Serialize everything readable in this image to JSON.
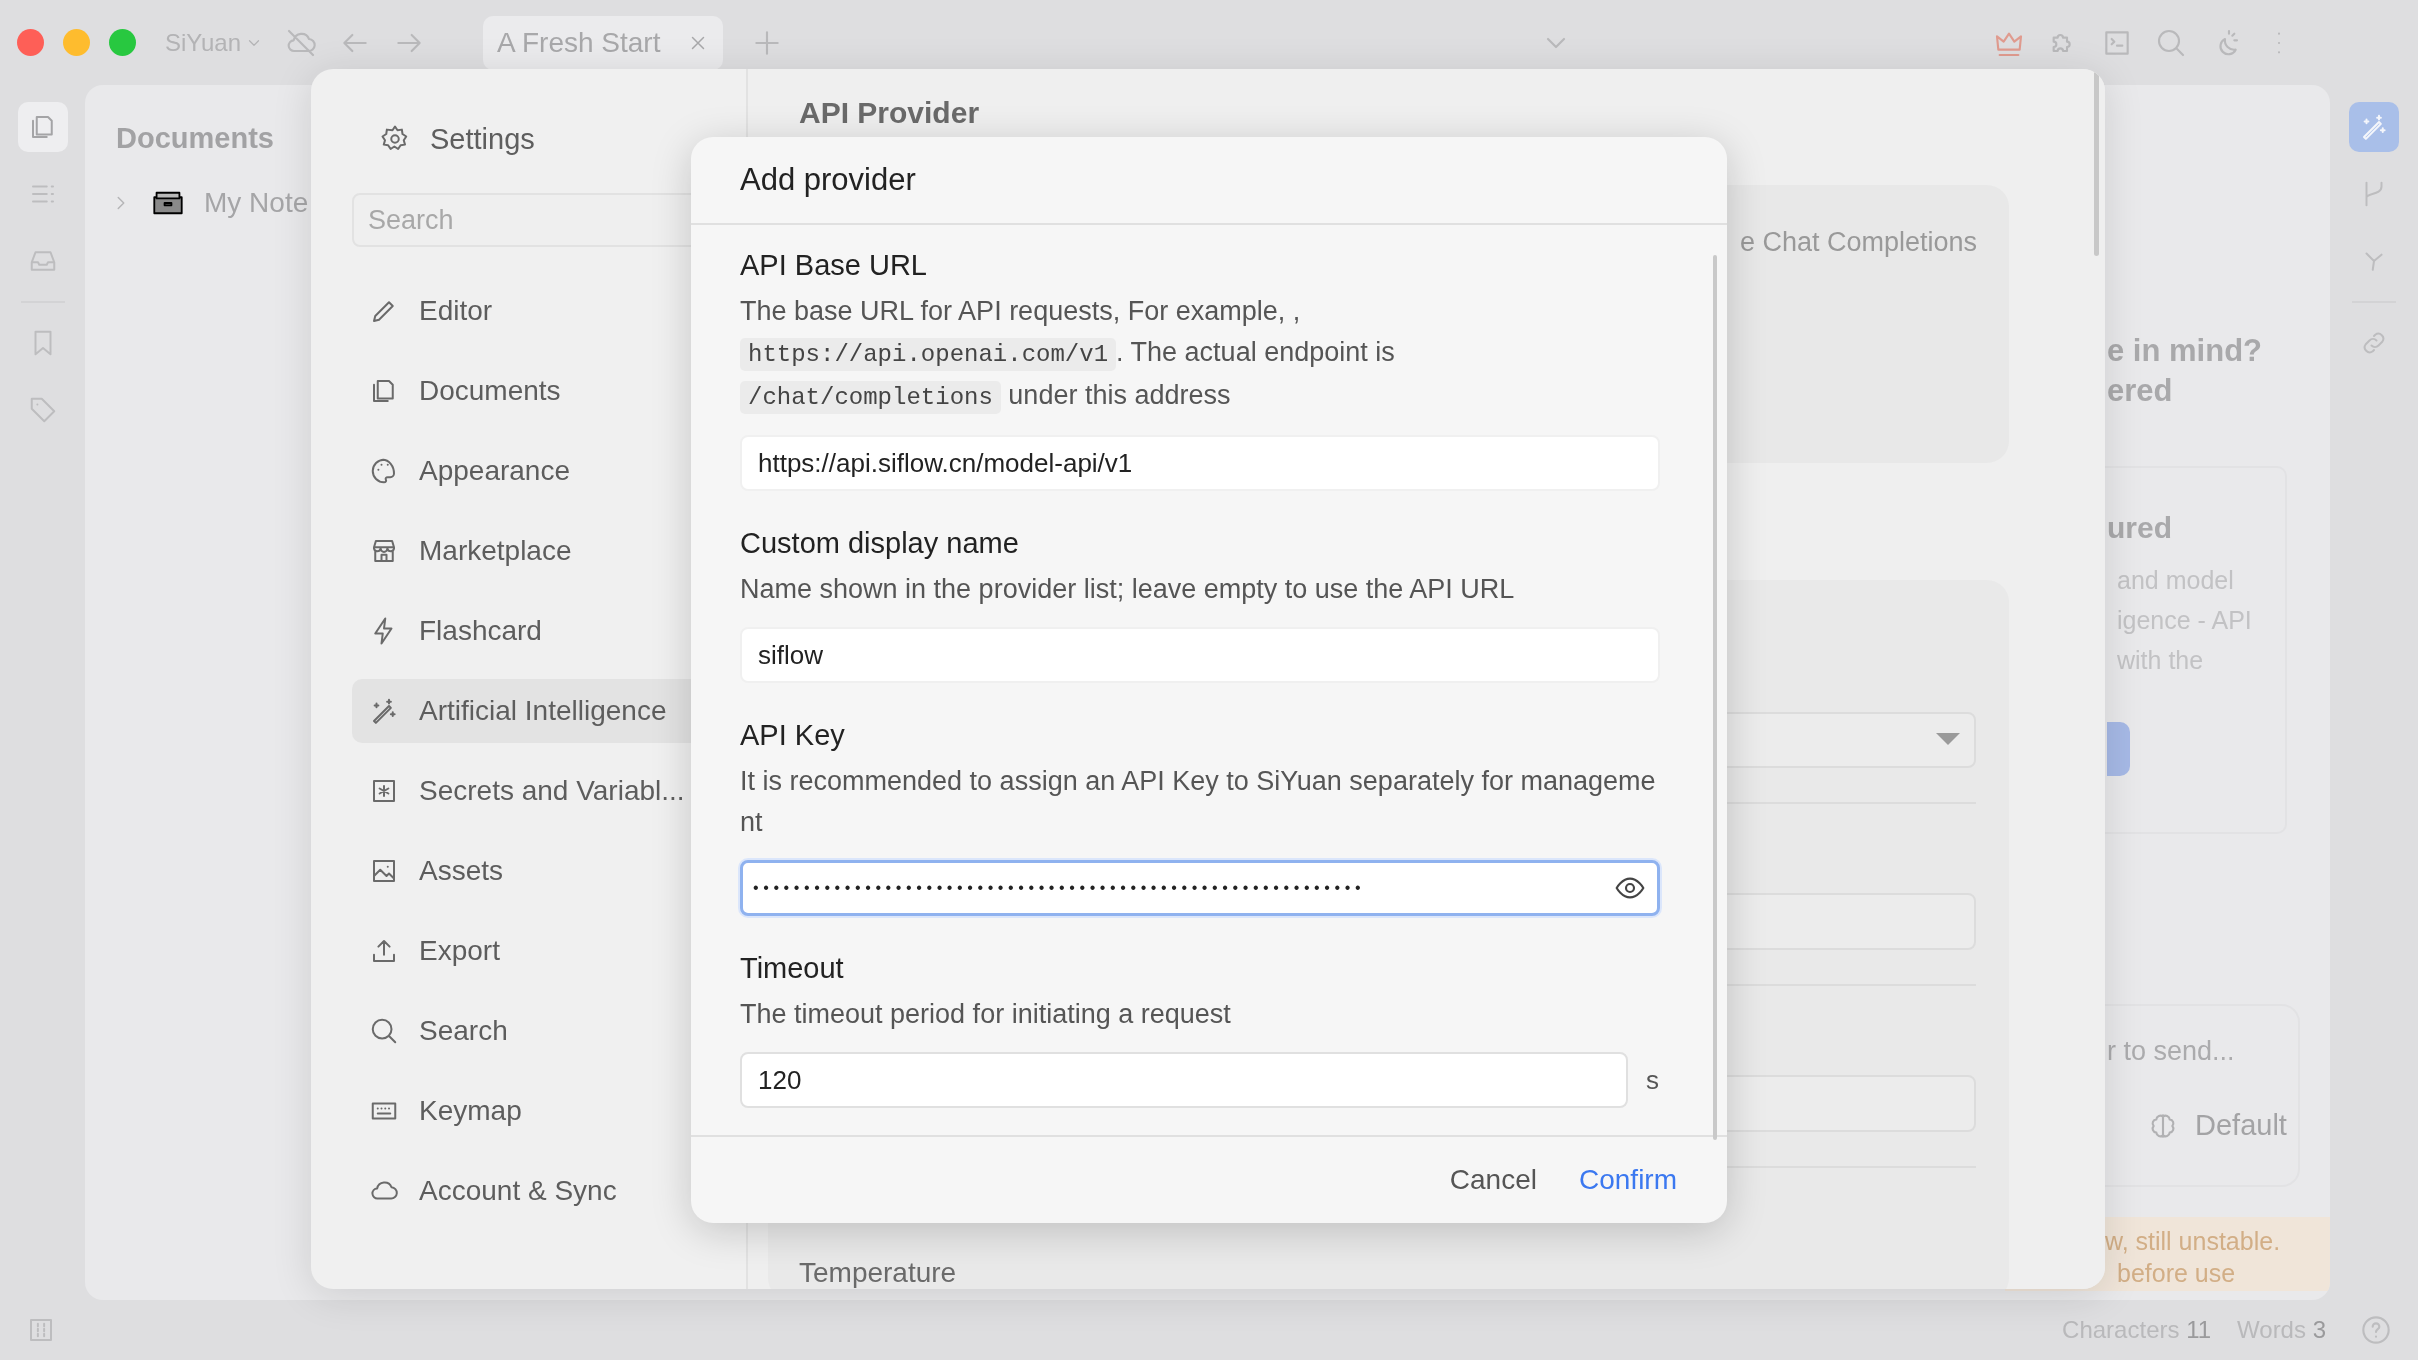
{
  "titlebar": {
    "workspace": "SiYuan",
    "tabs": [
      {
        "label": "A Fresh Start",
        "selected": true
      }
    ]
  },
  "left_dock": [
    {
      "selected": true
    },
    {
      "selected": false
    },
    {
      "selected": false
    },
    {
      "selected": false
    },
    {
      "selected": false
    }
  ],
  "right_dock": [
    {
      "selected": true
    },
    {
      "selected": false
    },
    {
      "selected": false
    },
    {
      "selected": false
    }
  ],
  "documents_panel": {
    "title": "Documents",
    "notebooks": [
      {
        "label": "My Note",
        "expanded": false
      }
    ]
  },
  "settings": {
    "title": "Settings",
    "search": {
      "placeholder": "Search"
    },
    "nav": [
      {
        "label": "Editor",
        "selected": false
      },
      {
        "label": "Documents",
        "selected": false
      },
      {
        "label": "Appearance",
        "selected": false
      },
      {
        "label": "Marketplace",
        "selected": false
      },
      {
        "label": "Flashcard",
        "selected": false
      },
      {
        "label": "Artificial Intelligence",
        "selected": true
      },
      {
        "label": "Secrets and Variabl...",
        "selected": false
      },
      {
        "label": "Assets",
        "selected": false
      },
      {
        "label": "Export",
        "selected": false
      },
      {
        "label": "Search",
        "selected": false
      },
      {
        "label": "Keymap",
        "selected": false
      },
      {
        "label": "Account & Sync",
        "selected": false
      }
    ],
    "content": {
      "heading": "API Provider",
      "card_text": "e Chat Completions",
      "temperature_label": "Temperature"
    }
  },
  "editor": {
    "headline": [
      "e in mind?",
      "ered"
    ],
    "card": {
      "title": "ured",
      "lines": [
        "and model",
        "igence - API",
        "with the"
      ]
    },
    "chat": {
      "placeholder": "r to send...",
      "model": "Default"
    },
    "warning": [
      "w, still unstable.",
      "before use"
    ]
  },
  "dialog": {
    "title": "Add provider",
    "fields": [
      {
        "kind": "text",
        "label": "API Base URL",
        "description": [
          {
            "text": "The base URL for API requests, For example, , ",
            "code": false
          },
          {
            "text": "https://api.openai.com/v1",
            "code": true
          },
          {
            "text": ". The actual endpoint is ",
            "code": false
          },
          {
            "text": "/chat/completions",
            "code": true
          },
          {
            "text": " under this address",
            "code": false
          }
        ],
        "value": "https://api.siflow.cn/model-api/v1",
        "focused": false
      },
      {
        "kind": "text",
        "label": "Custom display name",
        "description": [
          {
            "text": "Name shown in the provider list; leave empty to use the API URL",
            "code": false
          }
        ],
        "value": "siflow",
        "focused": false
      },
      {
        "kind": "secret",
        "label": "API Key",
        "description": [
          {
            "text": "It is recommended to assign an API Key to SiYuan separately for management",
            "code": false
          }
        ],
        "value": "••••••••••••••••••••••••••••••••••••••••••••••••••••••••••••",
        "focused": true
      },
      {
        "kind": "number",
        "label": "Timeout",
        "description": [
          {
            "text": "The timeout period for initiating a request",
            "code": false
          }
        ],
        "value": "120",
        "unit": "s",
        "focused": false
      }
    ],
    "buttons": [
      {
        "label": "Cancel",
        "primary": false
      },
      {
        "label": "Confirm",
        "primary": true
      }
    ]
  },
  "status_bar": {
    "characters_label": "Characters",
    "characters": "11",
    "words_label": "Words",
    "words": "3"
  }
}
